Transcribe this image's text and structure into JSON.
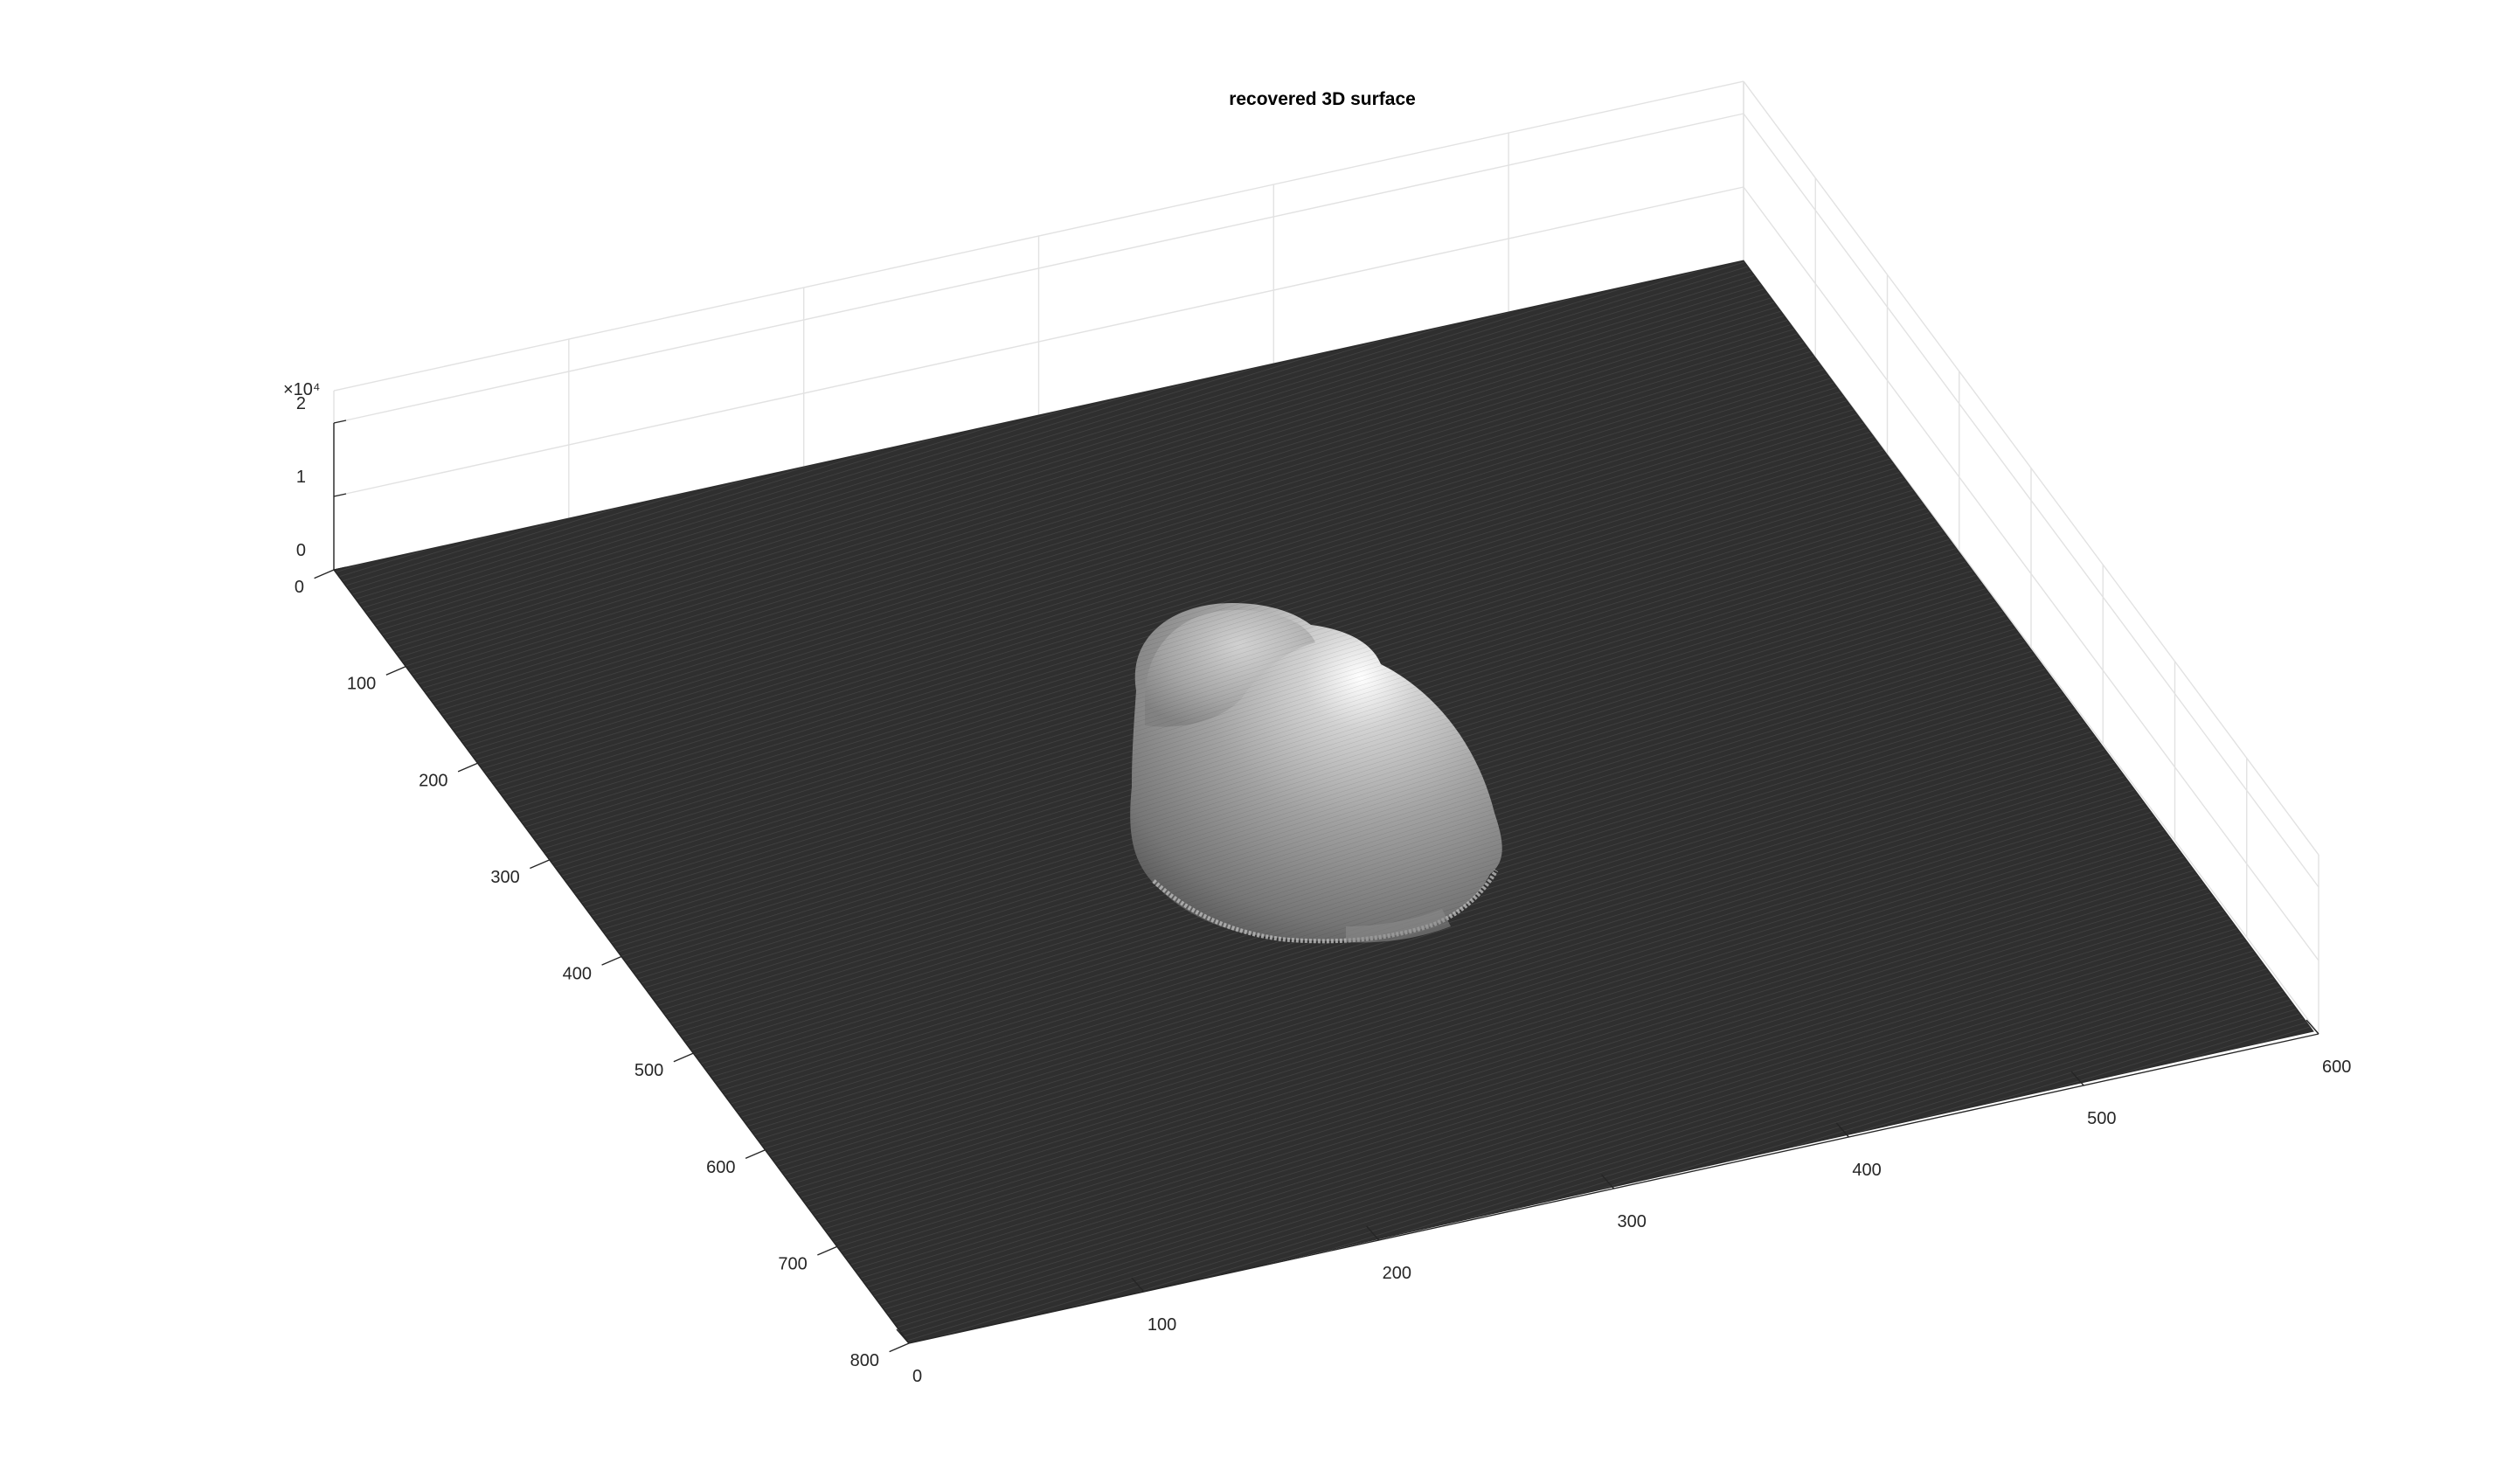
{
  "chart_data": {
    "type": "surface",
    "title": "recovered 3D surface",
    "xlabel": "",
    "ylabel": "",
    "zlabel": "",
    "x_ticks": [
      0,
      100,
      200,
      300,
      400,
      500,
      600,
      700,
      800
    ],
    "y_ticks": [
      0,
      100,
      200,
      300,
      400,
      500,
      600
    ],
    "z_ticks": [
      0,
      1,
      2
    ],
    "z_exponent": "×10⁴",
    "xlim": [
      0,
      800
    ],
    "ylim": [
      0,
      600
    ],
    "zlim": [
      0,
      2
    ],
    "grid": true,
    "colormap": "gray",
    "surface_color": "#333333",
    "feature": "single smooth dome-shaped bump near the center of the plane, flat elsewhere"
  }
}
